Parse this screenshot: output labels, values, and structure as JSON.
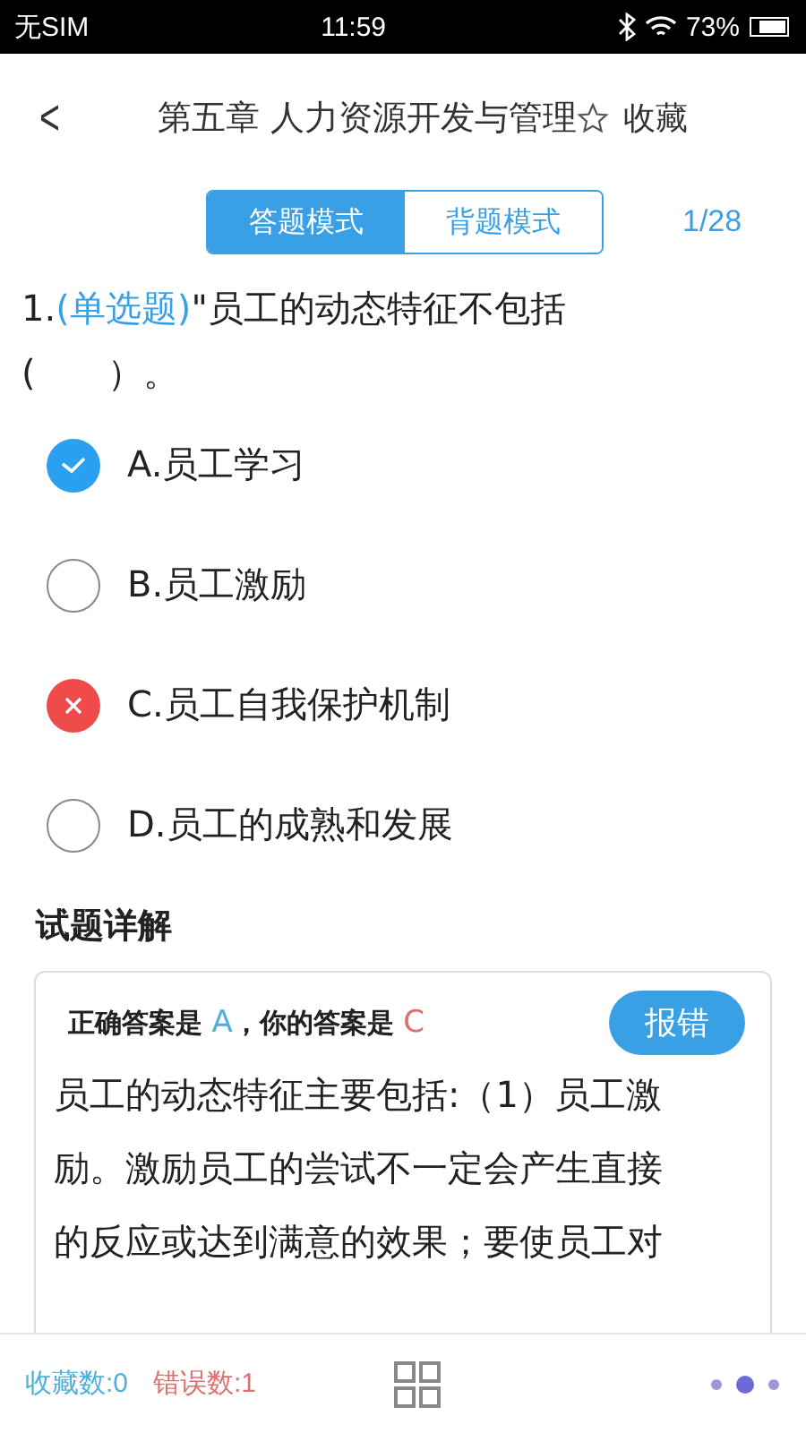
{
  "status_bar": {
    "carrier": "无SIM",
    "time": "11:59",
    "battery": "73%"
  },
  "header": {
    "back": "<",
    "title": "第五章 人力资源开发与管理",
    "favorite": "收藏"
  },
  "mode_tabs": [
    {
      "label": "答题模式",
      "selected": true
    },
    {
      "label": "背题模式",
      "selected": false
    }
  ],
  "progress": "1/28",
  "question": {
    "number": "1.",
    "type": "(单选题)",
    "text": "\"员工的动态特征不包括",
    "blank": "(　　）。"
  },
  "options": [
    {
      "label": "A.员工学习",
      "kind": "correct",
      "checked": true
    },
    {
      "label": "B.员工激励",
      "checked": false
    },
    {
      "label": "C.员工自我保护机制",
      "kind": "wrong",
      "checked": true
    },
    {
      "label": "D.员工的成熟和发展",
      "checked": false
    }
  ],
  "explanation": {
    "heading": "试题详解",
    "correct_prefix": "正确答案是",
    "correct": "A",
    "your_prefix": "，你的答案是",
    "yours": "C",
    "report_button": "报错",
    "lines": [
      "员工的动态特征主要包括:（1）员工激",
      "励。激励员工的尝试不一定会产生直接",
      "的反应或达到满意的效果；要使员工对"
    ]
  },
  "footer": {
    "favorites": "收藏数:0",
    "errors": "错误数:1"
  }
}
